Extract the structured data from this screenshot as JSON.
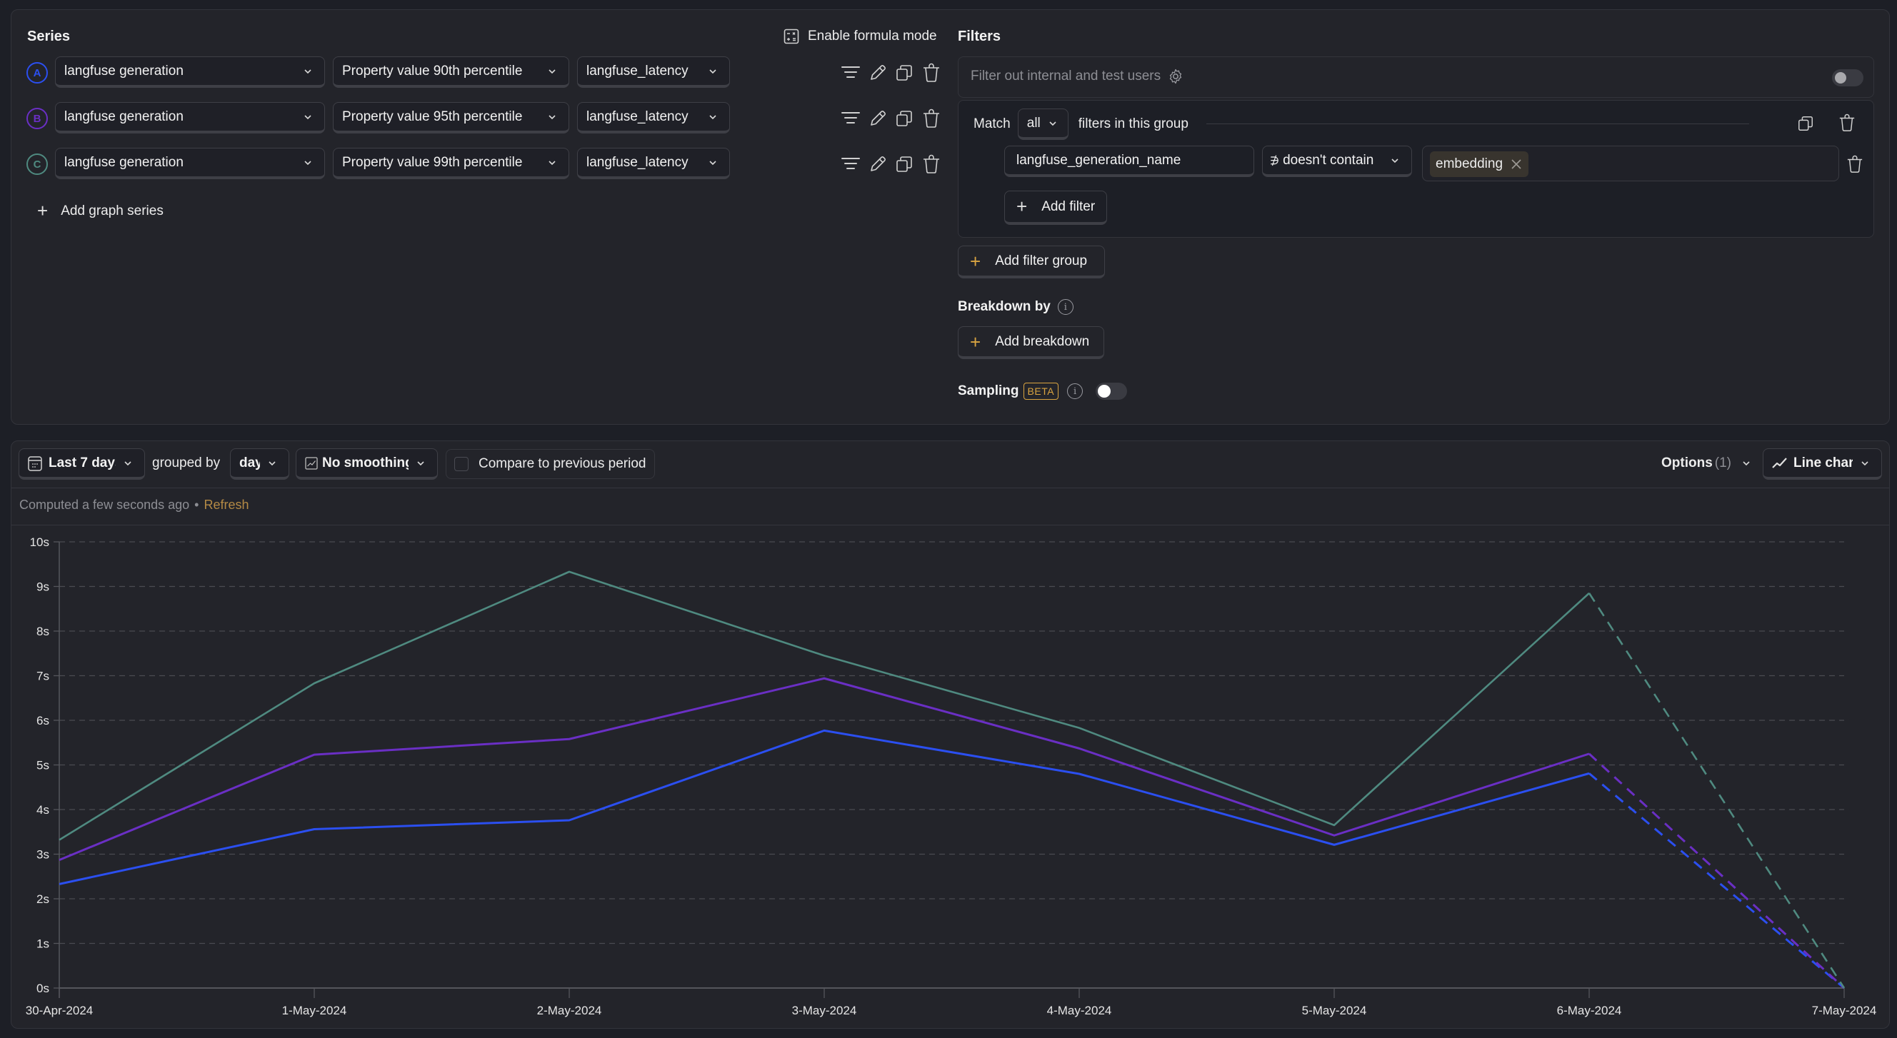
{
  "series_section": {
    "title": "Series",
    "formula_mode_label": "Enable formula mode",
    "add_series_label": "Add graph series",
    "rows": [
      {
        "letter": "A",
        "color": "#2b4ff0",
        "event": "langfuse generation",
        "aggregation": "Property value 90th percentile",
        "property": "langfuse_latency"
      },
      {
        "letter": "B",
        "color": "#6a2fc4",
        "event": "langfuse generation",
        "aggregation": "Property value 95th percentile",
        "property": "langfuse_latency"
      },
      {
        "letter": "C",
        "color": "#4f8a80",
        "event": "langfuse generation",
        "aggregation": "Property value 99th percentile",
        "property": "langfuse_latency"
      }
    ],
    "row_actions": [
      "filter-icon",
      "edit-icon",
      "duplicate-icon",
      "delete-icon"
    ]
  },
  "filters": {
    "title": "Filters",
    "internal_users_label": "Filter out internal and test users",
    "internal_users_enabled": false,
    "group": {
      "match_prefix": "Match",
      "match_value": "all",
      "match_suffix": "filters in this group",
      "filter": {
        "property": "langfuse_generation_name",
        "operator_symbol": "∌",
        "operator": "doesn't contain",
        "values": [
          "embedding"
        ]
      },
      "add_filter_label": "Add filter"
    },
    "add_filter_group_label": "Add filter group"
  },
  "breakdown": {
    "title": "Breakdown by",
    "add_label": "Add breakdown"
  },
  "sampling": {
    "label": "Sampling",
    "badge": "BETA",
    "enabled": false
  },
  "toolbar": {
    "date_range": "Last 7 days",
    "grouped_by_label": "grouped by",
    "interval": "day",
    "smoothing": "No smoothing",
    "compare_label": "Compare to previous period",
    "compare_checked": false,
    "options_label": "Options",
    "options_count": "(1)",
    "chart_type": "Line chart"
  },
  "status": {
    "computed": "Computed a few seconds ago",
    "separator": "•",
    "refresh": "Refresh"
  },
  "colors": {
    "accent": "#d9a441",
    "series_a": "#2b4ff0",
    "series_b": "#6a2fc4",
    "series_c": "#4f8a80"
  },
  "chart_data": {
    "type": "line",
    "title": "",
    "xlabel": "",
    "ylabel": "",
    "x": [
      "30-Apr-2024",
      "1-May-2024",
      "2-May-2024",
      "3-May-2024",
      "4-May-2024",
      "5-May-2024",
      "6-May-2024",
      "7-May-2024"
    ],
    "y_ticks": [
      "0s",
      "1s",
      "2s",
      "3s",
      "4s",
      "5s",
      "6s",
      "7s",
      "8s",
      "9s",
      "10s"
    ],
    "ylim": [
      0,
      10
    ],
    "y_unit": "s",
    "grid": true,
    "legend": "none",
    "incomplete_from_index": 6,
    "series": [
      {
        "name": "A",
        "label": "langfuse generation - Property value 90th percentile (langfuse_latency)",
        "color": "#2b4ff0",
        "values": [
          2.33,
          3.56,
          3.76,
          5.77,
          4.8,
          3.21,
          4.81,
          0
        ]
      },
      {
        "name": "B",
        "label": "langfuse generation - Property value 95th percentile (langfuse_latency)",
        "color": "#6a2fc4",
        "values": [
          2.87,
          5.23,
          5.58,
          6.94,
          5.37,
          3.42,
          5.25,
          0
        ]
      },
      {
        "name": "C",
        "label": "langfuse generation - Property value 99th percentile (langfuse_latency)",
        "color": "#4f8a80",
        "values": [
          3.32,
          6.83,
          9.33,
          7.45,
          5.83,
          3.65,
          8.85,
          0
        ]
      }
    ]
  }
}
